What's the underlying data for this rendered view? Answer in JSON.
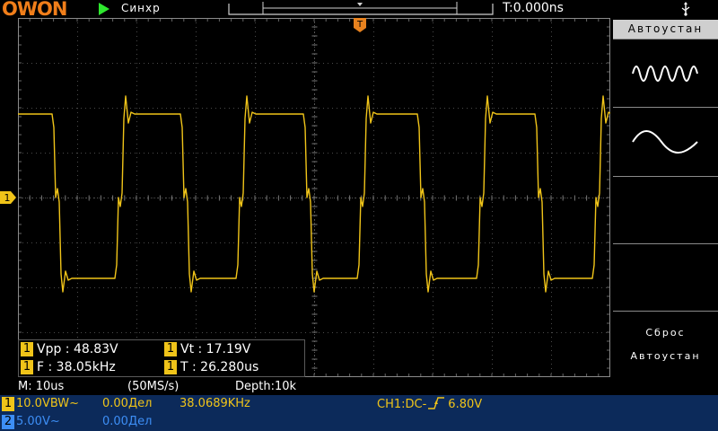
{
  "topbar": {
    "brand": "OWON",
    "trigger_status": "Синхр",
    "time_offset": "T:0.000ns"
  },
  "right_panel": {
    "title": "Автоустан",
    "reset_line1": "Сброс",
    "reset_line2": "Автоустан",
    "icons": [
      "multi-period-wave-icon",
      "single-period-wave-icon"
    ]
  },
  "markers": {
    "trigger_top": "T",
    "channel1_ref": "1"
  },
  "measurements": {
    "vpp": {
      "channel": "1",
      "text": "Vpp : 48.83V"
    },
    "vt": {
      "channel": "1",
      "text": "Vt : 17.19V"
    },
    "freq": {
      "channel": "1",
      "text": "F : 38.05kHz"
    },
    "period": {
      "channel": "1",
      "text": "T : 26.280us"
    }
  },
  "status": {
    "timebase": "M: 10us",
    "sample_rate": "(50MS/s)",
    "depth": "Depth:10k"
  },
  "channels": [
    {
      "num": "1",
      "scale": "10.0VBW~",
      "offset": "0.00Дел",
      "color": "#f0c419"
    },
    {
      "num": "2",
      "scale": "5.00V~",
      "offset": "0.00Дел",
      "color": "#3d8ef5"
    }
  ],
  "trigger": {
    "frequency": "38.0689KHz",
    "source": "CH1:DC-",
    "level": "6.80V"
  },
  "colors": {
    "ch1_trace": "#f0c419",
    "ch2": "#3d8ef5",
    "brand": "#f07e1a",
    "bottom_bar": "#0c2a5a"
  }
}
